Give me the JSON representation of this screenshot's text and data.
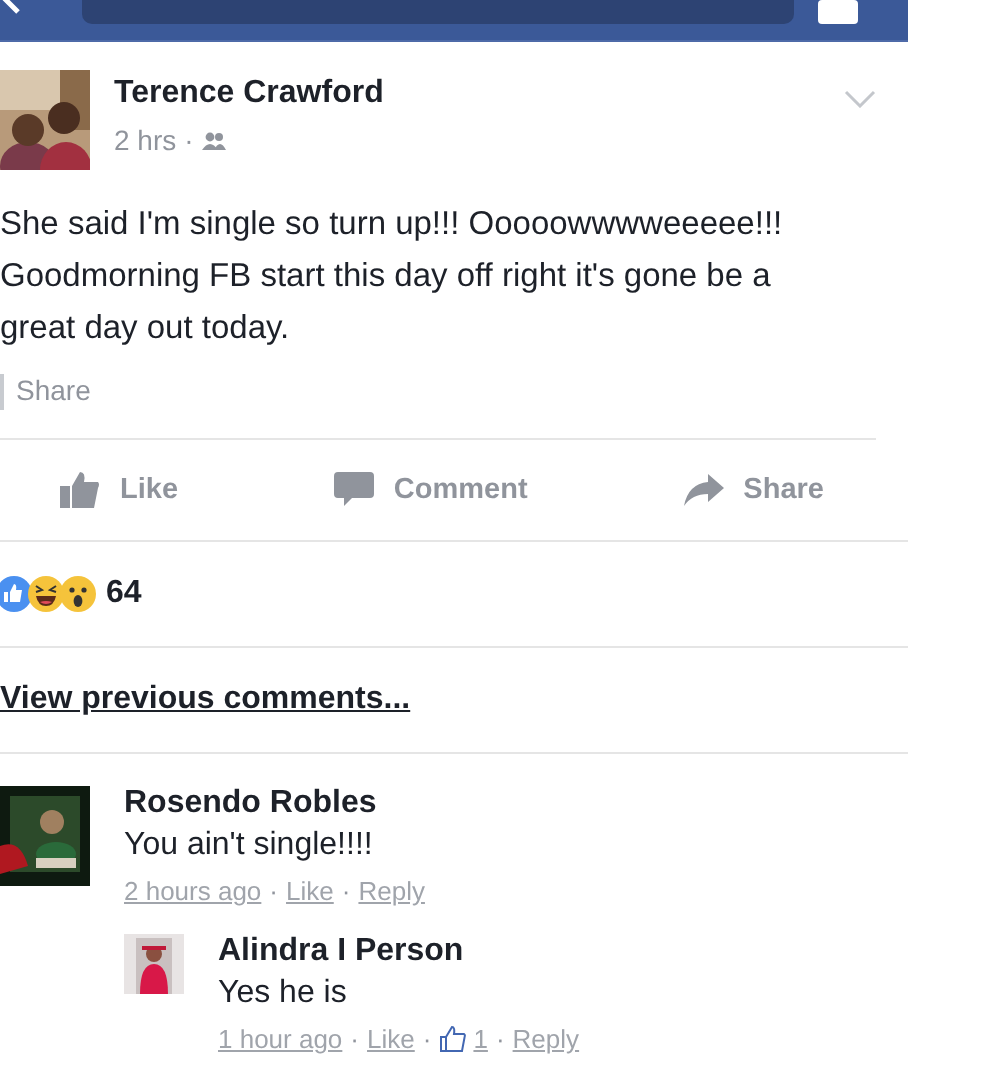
{
  "post": {
    "author": "Terence Crawford",
    "time": "2 hrs",
    "separator": "·",
    "text": "She said I'm single so turn up!!! Ooooowwwweeeee!!! Goodmorning FB start this day off right it's gone be a great day out today.",
    "share_link": "Share"
  },
  "actions": [
    {
      "kind": "like",
      "label": "Like"
    },
    {
      "kind": "comment",
      "label": "Comment"
    },
    {
      "kind": "share",
      "label": "Share"
    }
  ],
  "reactions": {
    "icons": [
      {
        "kind": "like"
      },
      {
        "kind": "haha"
      },
      {
        "kind": "wow"
      }
    ],
    "count": "64"
  },
  "view_previous": "View previous comments...",
  "comments": [
    {
      "name": "Rosendo Robles",
      "text": "You ain't single!!!!",
      "meta": [
        {
          "kind": "link",
          "text": "2 hours ago"
        },
        {
          "kind": "separator",
          "text": "·"
        },
        {
          "kind": "link",
          "text": "Like"
        },
        {
          "kind": "separator",
          "text": "·"
        },
        {
          "kind": "link",
          "text": "Reply"
        }
      ],
      "replies": [
        {
          "name": "Alindra I Person",
          "text": "Yes he is",
          "meta": [
            {
              "kind": "link",
              "text": "1 hour ago"
            },
            {
              "kind": "separator",
              "text": "·"
            },
            {
              "kind": "link",
              "text": "Like"
            },
            {
              "kind": "separator",
              "text": "·"
            },
            {
              "kind": "likes",
              "text": "1"
            },
            {
              "kind": "separator",
              "text": "·"
            },
            {
              "kind": "link",
              "text": "Reply"
            }
          ]
        }
      ]
    }
  ]
}
